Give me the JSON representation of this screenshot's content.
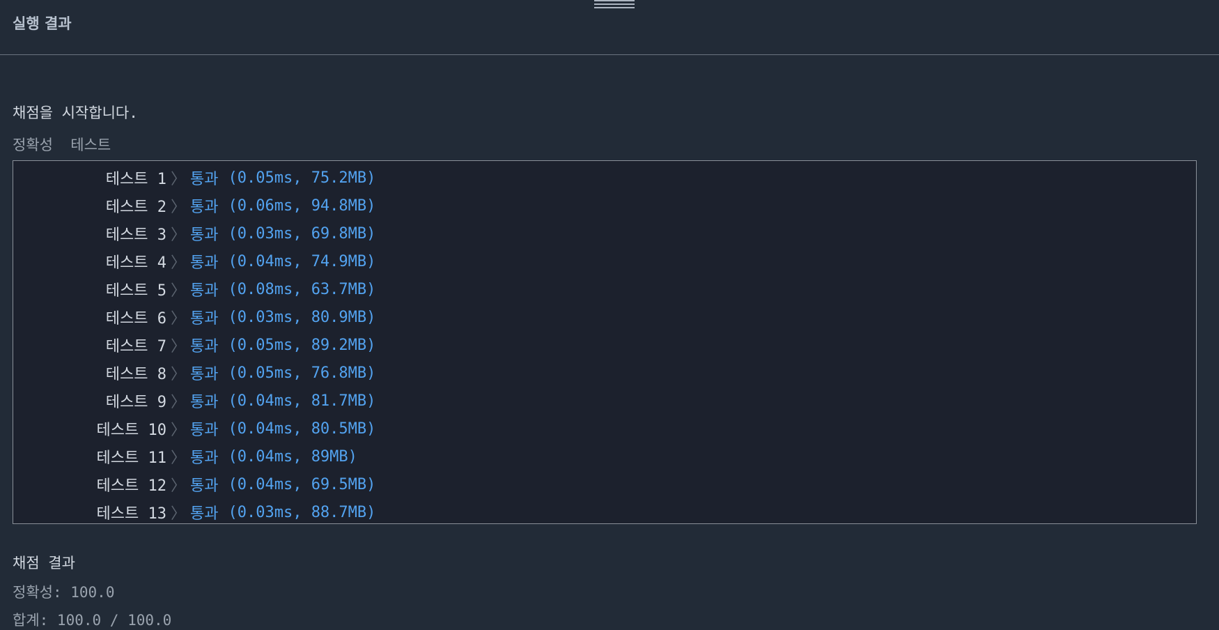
{
  "header": {
    "title": "실행 결과"
  },
  "grading": {
    "start_message": "채점을 시작합니다.",
    "section_label": "정확성  테스트",
    "tests": [
      {
        "name": "테스트 1",
        "status": "통과",
        "detail": "(0.05ms, 75.2MB)"
      },
      {
        "name": "테스트 2",
        "status": "통과",
        "detail": "(0.06ms, 94.8MB)"
      },
      {
        "name": "테스트 3",
        "status": "통과",
        "detail": "(0.03ms, 69.8MB)"
      },
      {
        "name": "테스트 4",
        "status": "통과",
        "detail": "(0.04ms, 74.9MB)"
      },
      {
        "name": "테스트 5",
        "status": "통과",
        "detail": "(0.08ms, 63.7MB)"
      },
      {
        "name": "테스트 6",
        "status": "통과",
        "detail": "(0.03ms, 80.9MB)"
      },
      {
        "name": "테스트 7",
        "status": "통과",
        "detail": "(0.05ms, 89.2MB)"
      },
      {
        "name": "테스트 8",
        "status": "통과",
        "detail": "(0.05ms, 76.8MB)"
      },
      {
        "name": "테스트 9",
        "status": "통과",
        "detail": "(0.04ms, 81.7MB)"
      },
      {
        "name": "테스트 10",
        "status": "통과",
        "detail": "(0.04ms, 80.5MB)"
      },
      {
        "name": "테스트 11",
        "status": "통과",
        "detail": "(0.04ms, 89MB)"
      },
      {
        "name": "테스트 12",
        "status": "통과",
        "detail": "(0.04ms, 69.5MB)"
      },
      {
        "name": "테스트 13",
        "status": "통과",
        "detail": "(0.03ms, 88.7MB)"
      }
    ],
    "separator": "〉",
    "result_title": "채점 결과",
    "accuracy_line": "정확성: 100.0",
    "total_line": "합계: 100.0 / 100.0"
  },
  "colors": {
    "background": "#222b37",
    "box_background": "#1c212d",
    "pass_blue": "#53a3f0"
  }
}
